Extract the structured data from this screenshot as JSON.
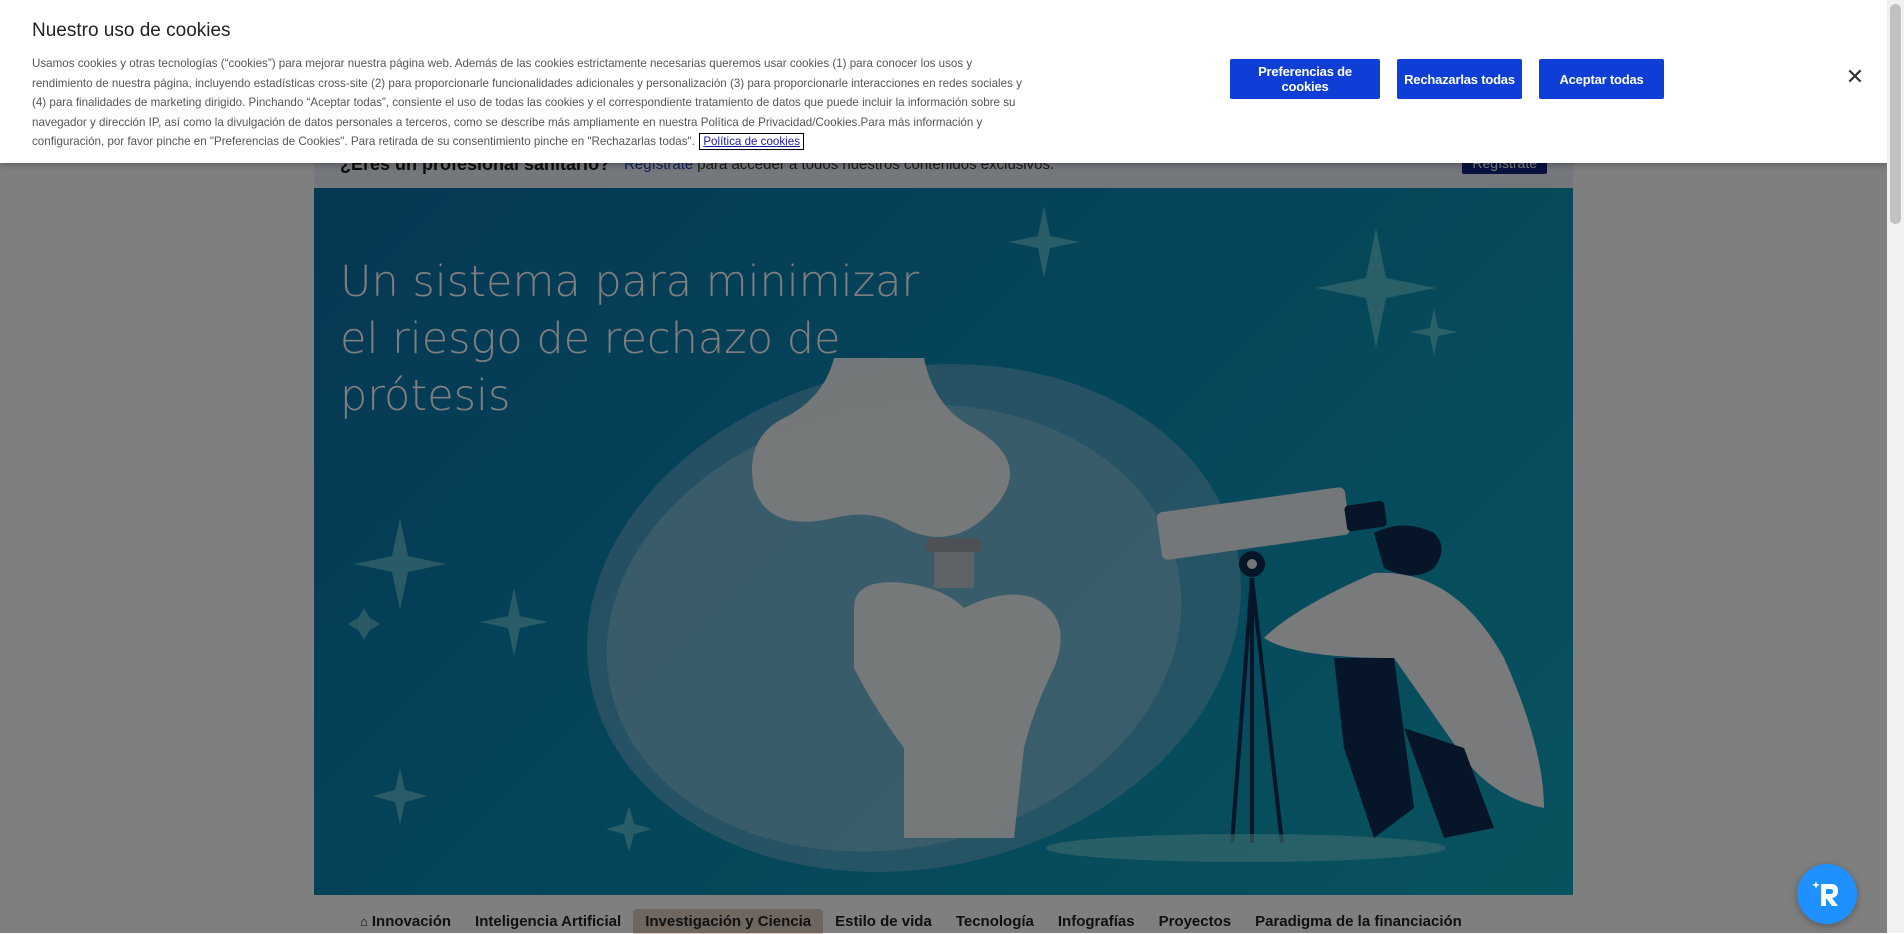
{
  "professional_bar": {
    "question": "¿Eres un profesional sanitario?",
    "register_link": "Regístrate",
    "description": "para acceder a todos nuestros contenidos exclusivos.",
    "register_button": "Regístrate"
  },
  "hero": {
    "title": "Un sistema para minimizar el riesgo de rechazo de prótesis"
  },
  "category_nav": {
    "items": [
      {
        "label": "Innovación",
        "icon": "home-icon"
      },
      {
        "label": "Inteligencia Artificial"
      },
      {
        "label": "Investigación y Ciencia",
        "active": true
      },
      {
        "label": "Estilo de vida"
      },
      {
        "label": "Tecnología"
      },
      {
        "label": "Infografías"
      },
      {
        "label": "Proyectos"
      },
      {
        "label": "Paradigma de la financiación"
      }
    ]
  },
  "cookie_banner": {
    "title": "Nuestro uso de cookies",
    "body": "Usamos cookies y otras tecnologías (“cookies”) para mejorar nuestra página web. Además de las cookies estrictamente necesarias queremos usar cookies (1) para conocer los usos y rendimiento de nuestra página, incluyendo estadísticas cross-site (2) para proporcionarle funcionalidades adicionales y personalización (3) para proporcionarle interacciones en redes sociales y (4) para finalidades de marketing dirigido. Pinchando “Aceptar todas”, consiente el uso de todas las cookies y el correspondiente tratamiento de datos que puede incluir la información sobre su navegador y dirección IP, así como la divulgación de datos personales a terceros, como se describe más ampliamente en nuestra Política de Privacidad/Cookies.Para más información y configuración, por favor pinche en \"Preferencias de Cookies\". Para retirada de su consentimiento pinche en \"Rechazarlas todas\".",
    "policy_link": "Política de cookies",
    "preferences_button": "Preferencias de cookies",
    "reject_button": "Rechazarlas todas",
    "accept_button": "Aceptar todas",
    "close_icon": "close-icon"
  },
  "colors": {
    "primary_button": "#0e3ed6",
    "hero_start": "#0c6fa8",
    "hero_end": "#11a6be",
    "fab": "#1e90ff"
  },
  "widget": {
    "icon": "accessibility-widget-icon"
  }
}
